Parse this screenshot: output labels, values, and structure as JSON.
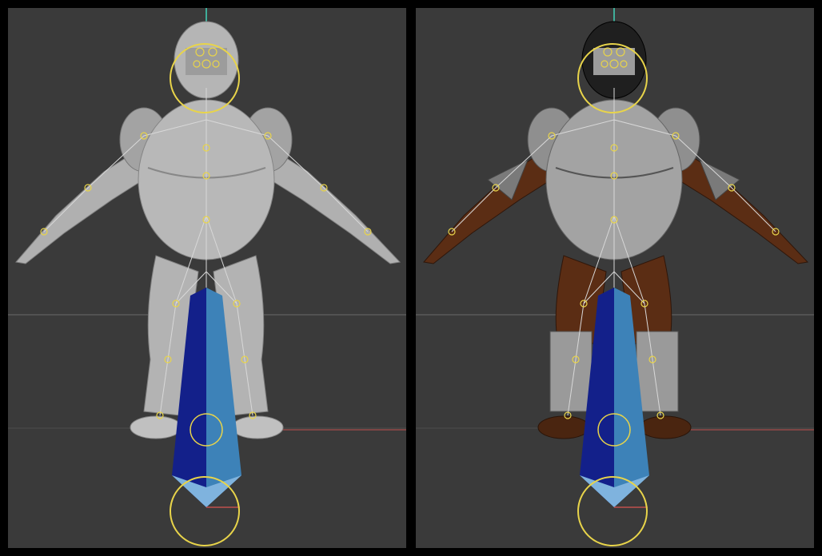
{
  "viewports": [
    {
      "id": "left",
      "render_mode": "clay-shaded"
    },
    {
      "id": "right",
      "render_mode": "textured"
    }
  ],
  "colors": {
    "background": "#3a3a3a",
    "frame": "#000000",
    "horizon_line": "#5a5a5a",
    "axis_x": "#c0504d",
    "axis_y": "#3fae9a",
    "clay": "#b5b5b5",
    "armor": "#9a9a9a",
    "skin": "#5b2d14",
    "rig_joint": "#e8d44a",
    "bone_dark": "#13208a",
    "bone_light": "#4a93c8"
  },
  "icons": [
    "character-model",
    "rig-skeleton",
    "root-bone-gizmo",
    "head-control-circle",
    "root-control-circle"
  ]
}
